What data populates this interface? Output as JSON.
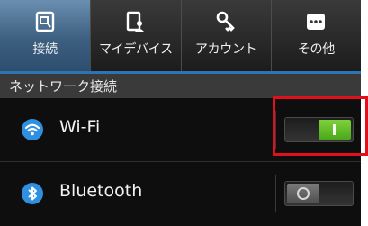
{
  "tabs": [
    {
      "label": "接続",
      "icon": "connections-icon",
      "active": true
    },
    {
      "label": "マイデバイス",
      "icon": "my-device-icon",
      "active": false
    },
    {
      "label": "アカウント",
      "icon": "account-key-icon",
      "active": false
    },
    {
      "label": "その他",
      "icon": "more-icon",
      "active": false
    }
  ],
  "section": {
    "title": "ネットワーク接続"
  },
  "rows": {
    "wifi": {
      "label": "Wi-Fi",
      "icon": "wifi-icon",
      "toggle_on": true
    },
    "bluetooth": {
      "label": "Bluetooth",
      "icon": "bluetooth-icon",
      "toggle_on": false
    }
  },
  "colors": {
    "accent": "#2c74b4",
    "toggle_on": "#5ab82a",
    "highlight": "#e0101c"
  }
}
